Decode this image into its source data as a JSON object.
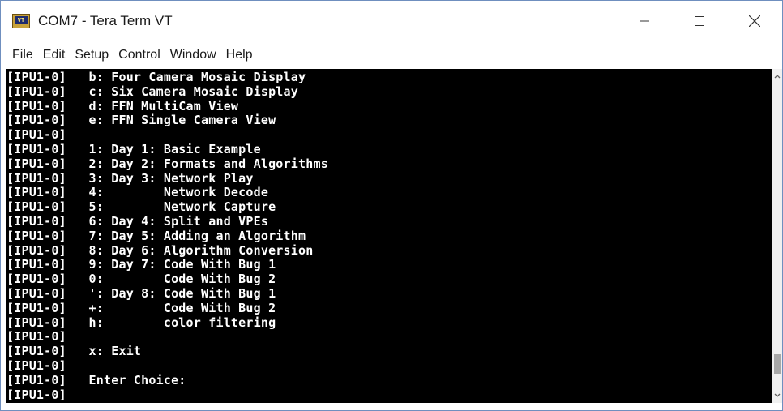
{
  "window": {
    "title": "COM7 - Tera Term VT",
    "icon_label": "VT",
    "icon": "teraterm-app-icon"
  },
  "controls": {
    "minimize": "minimize-icon",
    "maximize": "maximize-icon",
    "close": "close-icon"
  },
  "menu": {
    "items": [
      {
        "label": "File"
      },
      {
        "label": "Edit"
      },
      {
        "label": "Setup"
      },
      {
        "label": "Control"
      },
      {
        "label": "Window"
      },
      {
        "label": "Help"
      }
    ]
  },
  "terminal": {
    "background": "#000000",
    "foreground": "#ffffff",
    "lines": [
      "[IPU1-0]   b: Four Camera Mosaic Display",
      "[IPU1-0]   c: Six Camera Mosaic Display",
      "[IPU1-0]   d: FFN MultiCam View",
      "[IPU1-0]   e: FFN Single Camera View",
      "[IPU1-0]",
      "[IPU1-0]   1: Day 1: Basic Example",
      "[IPU1-0]   2: Day 2: Formats and Algorithms",
      "[IPU1-0]   3: Day 3: Network Play",
      "[IPU1-0]   4:        Network Decode",
      "[IPU1-0]   5:        Network Capture",
      "[IPU1-0]   6: Day 4: Split and VPEs",
      "[IPU1-0]   7: Day 5: Adding an Algorithm",
      "[IPU1-0]   8: Day 6: Algorithm Conversion",
      "[IPU1-0]   9: Day 7: Code With Bug 1",
      "[IPU1-0]   0:        Code With Bug 2",
      "[IPU1-0]   ': Day 8: Code With Bug 1",
      "[IPU1-0]   +:        Code With Bug 2",
      "[IPU1-0]   h:        color filtering",
      "[IPU1-0]",
      "[IPU1-0]   x: Exit",
      "[IPU1-0]",
      "[IPU1-0]   Enter Choice:",
      "[IPU1-0]"
    ]
  },
  "scrollbar": {
    "up_icon": "scroll-up-arrow-icon",
    "down_icon": "scroll-down-arrow-icon",
    "position": 0.95
  }
}
